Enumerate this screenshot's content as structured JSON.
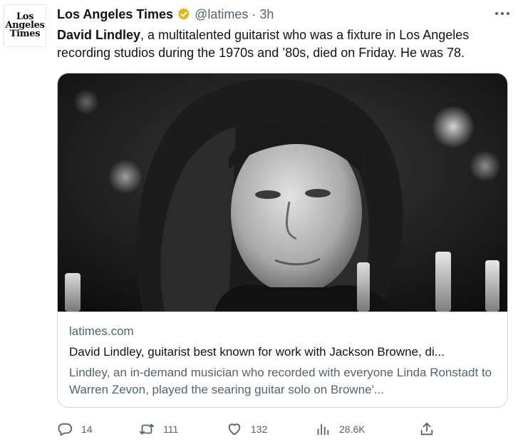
{
  "avatar": {
    "logo_lines": [
      "Los",
      "Angeles",
      "Times"
    ]
  },
  "header": {
    "name": "Los Angeles Times",
    "handle": "@latimes",
    "separator": "·",
    "time": "3h"
  },
  "tweet": {
    "bold_lead": "David Lindley",
    "text_rest": ", a multitalented guitarist who was a fixture in Los Angeles recording studios during the 1970s and ’80s, died on Friday. He was 78."
  },
  "card": {
    "domain": "latimes.com",
    "title": "David Lindley, guitarist best known for work with Jackson Browne, di...",
    "description": "Lindley, an in-demand musician who recorded with everyone Linda Ronstadt to Warren Zevon, played the searing guitar solo on Browne'..."
  },
  "actions": {
    "replies": "14",
    "retweets": "111",
    "likes": "132",
    "views": "28.6K"
  },
  "icons": {
    "verified": "verified-badge-icon",
    "more": "more-horizontal-icon",
    "reply": "reply-icon",
    "retweet": "retweet-icon",
    "like": "like-icon",
    "views": "views-icon",
    "share": "share-icon"
  },
  "colors": {
    "text": "#0f1419",
    "secondary": "#536471",
    "border": "#cfd9de",
    "verified_gold": "#e2b719"
  }
}
